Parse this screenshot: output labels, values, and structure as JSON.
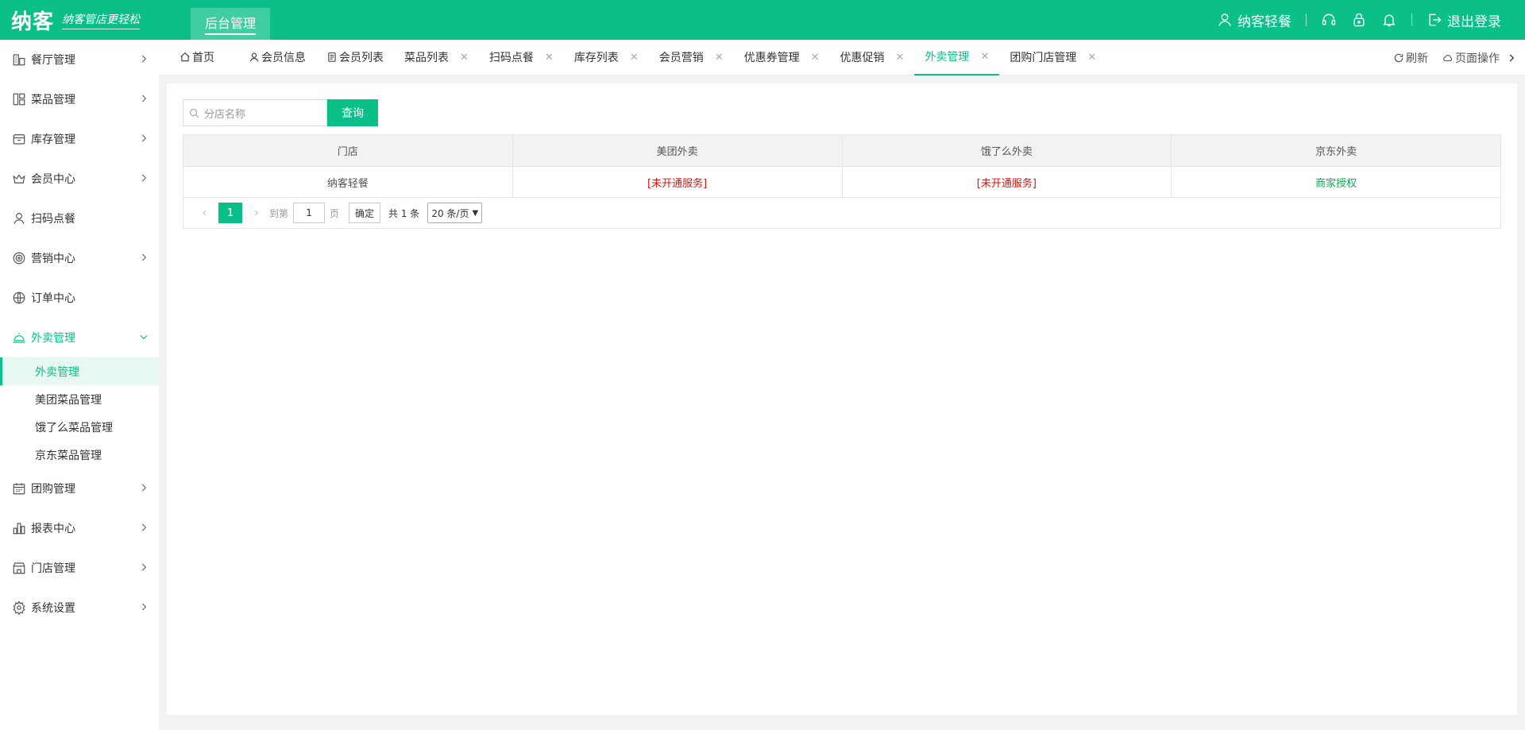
{
  "header": {
    "logo": "纳客",
    "slogan": "纳客管店更轻松",
    "admin_tab": "后台管理",
    "user_name": "纳客轻餐",
    "logout": "退出登录"
  },
  "sidebar": {
    "items": [
      {
        "label": "餐厅管理",
        "icon": "restaurant-icon",
        "has_arrow": true
      },
      {
        "label": "菜品管理",
        "icon": "dish-icon",
        "has_arrow": true
      },
      {
        "label": "库存管理",
        "icon": "inventory-icon",
        "has_arrow": true
      },
      {
        "label": "会员中心",
        "icon": "crown-icon",
        "has_arrow": true
      },
      {
        "label": "扫码点餐",
        "icon": "user-icon",
        "has_arrow": false
      },
      {
        "label": "营销中心",
        "icon": "target-icon",
        "has_arrow": true
      },
      {
        "label": "订单中心",
        "icon": "globe-icon",
        "has_arrow": false
      },
      {
        "label": "外卖管理",
        "icon": "cloche-icon",
        "has_arrow": true,
        "open": true
      },
      {
        "label": "团购管理",
        "icon": "calendar-icon",
        "has_arrow": true
      },
      {
        "label": "报表中心",
        "icon": "chart-icon",
        "has_arrow": true
      },
      {
        "label": "门店管理",
        "icon": "store-icon",
        "has_arrow": true
      },
      {
        "label": "系统设置",
        "icon": "gear-icon",
        "has_arrow": true
      }
    ],
    "submenu": [
      "外卖管理",
      "美团菜品管理",
      "饿了么菜品管理",
      "京东菜品管理"
    ]
  },
  "tabs": {
    "home": "首页",
    "member_info": "会员信息",
    "member_list": "会员列表",
    "dish_list": "菜品列表",
    "scan_order": "扫码点餐",
    "stock_list": "库存列表",
    "member_marketing": "会员营销",
    "coupon_mgmt": "优惠券管理",
    "promo": "优惠促销",
    "takeout_mgmt": "外卖管理",
    "group_store_mgmt": "团购门店管理",
    "refresh": "刷新",
    "page_ops": "页面操作"
  },
  "search": {
    "placeholder": "分店名称",
    "button": "查询"
  },
  "table": {
    "headers": [
      "门店",
      "美团外卖",
      "饿了么外卖",
      "京东外卖"
    ],
    "rows": [
      {
        "store": "纳客轻餐",
        "meituan": "[未开通服务]",
        "eleme": "[未开通服务]",
        "jd": "商家授权"
      }
    ]
  },
  "pager": {
    "current": "1",
    "goto_label": "到第",
    "goto_value": "1",
    "page_label": "页",
    "ok": "确定",
    "total": "共 1 条",
    "page_size": "20 条/页"
  },
  "colors": {
    "accent": "#0bbf88",
    "danger": "#e3120b",
    "success": "#16a85a"
  }
}
